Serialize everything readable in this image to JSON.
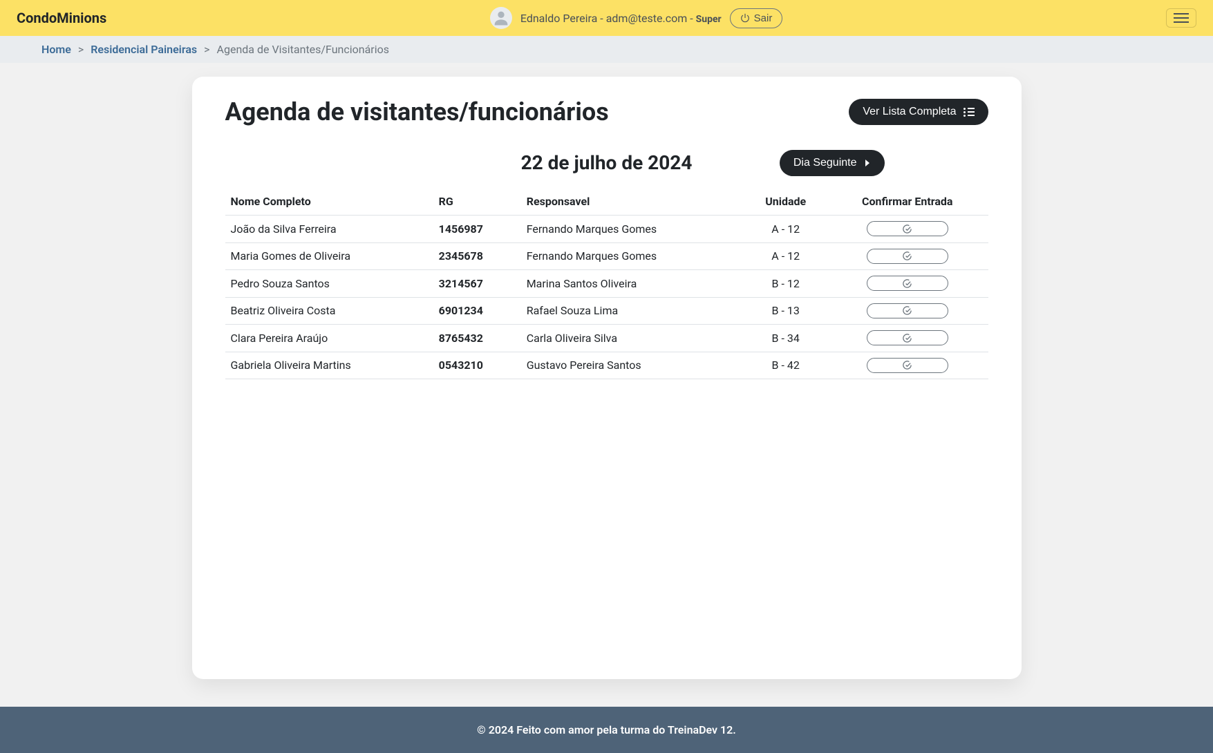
{
  "header": {
    "brand": "CondoMinions",
    "user_name": "Ednaldo Pereira",
    "user_email": "adm@teste.com",
    "user_role": "Super",
    "logout_label": "Sair"
  },
  "breadcrumb": {
    "home": "Home",
    "location": "Residencial Paineiras",
    "current": "Agenda de Visitantes/Funcionários"
  },
  "page": {
    "title": "Agenda de visitantes/funcionários",
    "full_list_label": "Ver Lista Completa",
    "date_label": "22 de julho de 2024",
    "next_day_label": "Dia Seguinte"
  },
  "table": {
    "headers": {
      "name": "Nome Completo",
      "rg": "RG",
      "responsible": "Responsavel",
      "unit": "Unidade",
      "confirm": "Confirmar Entrada"
    },
    "rows": [
      {
        "name": "João da Silva Ferreira",
        "rg": "1456987",
        "responsible": "Fernando Marques Gomes",
        "unit": "A - 12"
      },
      {
        "name": "Maria Gomes de Oliveira",
        "rg": "2345678",
        "responsible": "Fernando Marques Gomes",
        "unit": "A - 12"
      },
      {
        "name": "Pedro Souza Santos",
        "rg": "3214567",
        "responsible": "Marina Santos Oliveira",
        "unit": "B - 12"
      },
      {
        "name": "Beatriz Oliveira Costa",
        "rg": "6901234",
        "responsible": "Rafael Souza Lima",
        "unit": "B - 13"
      },
      {
        "name": "Clara Pereira Araújo",
        "rg": "8765432",
        "responsible": "Carla Oliveira Silva",
        "unit": "B - 34"
      },
      {
        "name": "Gabriela Oliveira Martins",
        "rg": "0543210",
        "responsible": "Gustavo Pereira Santos",
        "unit": "B - 42"
      }
    ]
  },
  "footer": {
    "text": "© 2024 Feito com amor pela turma do TreinaDev 12."
  }
}
